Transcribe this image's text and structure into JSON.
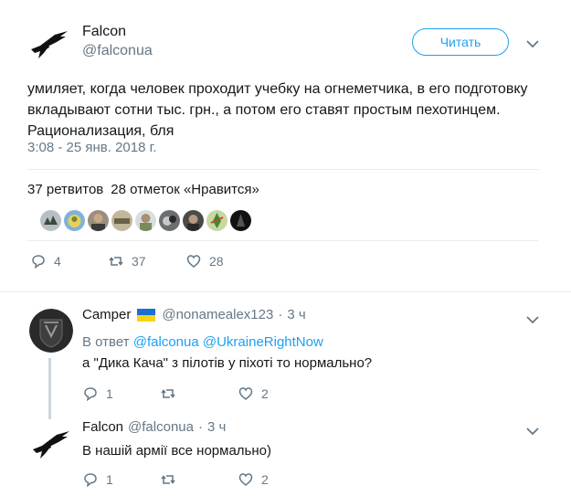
{
  "main_tweet": {
    "name": "Falcon",
    "handle": "@falconua",
    "follow_label": "Читать",
    "text": "умиляет, когда человек проходит учебку на огнеметчика, в его подготовку вкладывают сотни тыс. грн., а потом его ставят простым пехотинцем. Рационализация, бля",
    "timestamp": "3:08 - 25 янв. 2018 г.",
    "retweets_count": "37",
    "retweets_label": "ретвитов",
    "likes_count": "28",
    "likes_label": "отметок «Нравится»",
    "actions": {
      "replies": "4",
      "retweets": "37",
      "likes": "28"
    },
    "avatar_icon": "falcon-bird-icon"
  },
  "replies": [
    {
      "name": "Camper",
      "flag_icon": "ukraine-flag-icon",
      "handle": "@nonamealex123",
      "separator": "·",
      "time": "3 ч",
      "in_reply_prefix": "В ответ",
      "mention_1": "@falconua",
      "mention_2": "@UkraineRightNow",
      "text": "а \"Дика Кача\" з пілотів у піхоті то нормально?",
      "actions": {
        "replies": "1",
        "retweets": "",
        "likes": "2"
      }
    },
    {
      "name": "Falcon",
      "handle": "@falconua",
      "separator": "·",
      "time": "3 ч",
      "text": "В нашій армії все нормально)",
      "actions": {
        "replies": "1",
        "retweets": "",
        "likes": "2"
      }
    }
  ],
  "colors": {
    "accent": "#1da1f2",
    "muted": "#657786",
    "text": "#14171a",
    "divider": "#e6ecf0"
  }
}
